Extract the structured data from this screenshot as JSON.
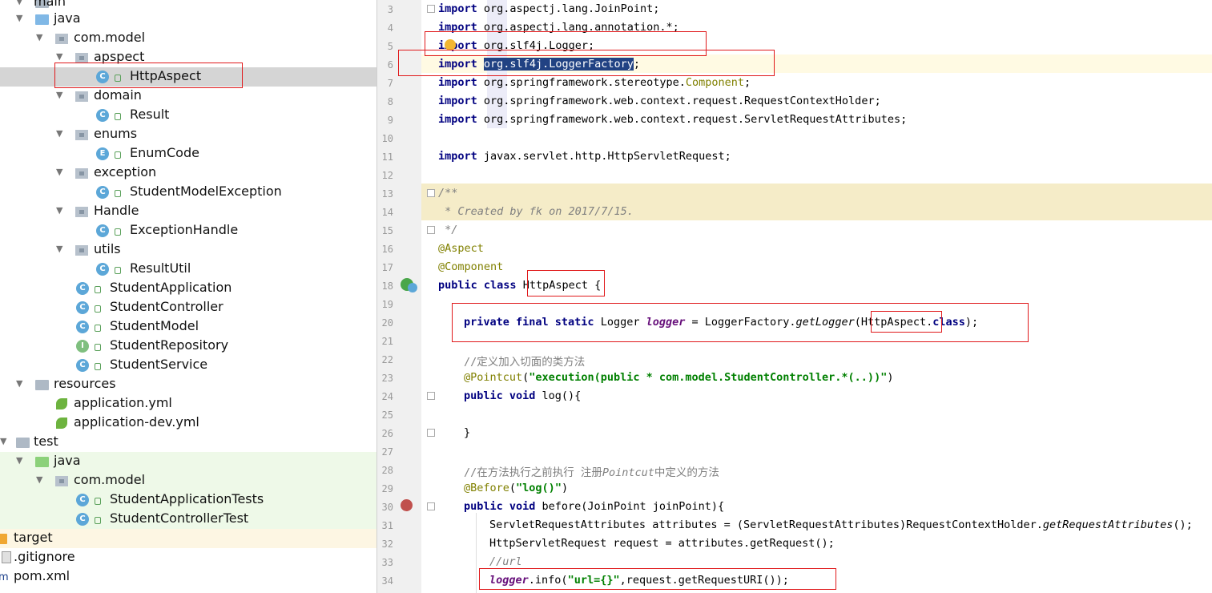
{
  "project_tree": {
    "items": [
      {
        "label": "main",
        "kind": "folder"
      },
      {
        "label": "java",
        "kind": "folder-blue"
      },
      {
        "label": "com.model",
        "kind": "package"
      },
      {
        "label": "apspect",
        "kind": "package"
      },
      {
        "label": "HttpAspect",
        "kind": "class",
        "badge": "C",
        "selected": true
      },
      {
        "label": "domain",
        "kind": "package"
      },
      {
        "label": "Result",
        "kind": "class",
        "badge": "C"
      },
      {
        "label": "enums",
        "kind": "package"
      },
      {
        "label": "EnumCode",
        "kind": "enum",
        "badge": "E"
      },
      {
        "label": "exception",
        "kind": "package"
      },
      {
        "label": "StudentModelException",
        "kind": "class",
        "badge": "C"
      },
      {
        "label": "Handle",
        "kind": "package"
      },
      {
        "label": "ExceptionHandle",
        "kind": "class",
        "badge": "C"
      },
      {
        "label": "utils",
        "kind": "package"
      },
      {
        "label": "ResultUtil",
        "kind": "class",
        "badge": "C"
      },
      {
        "label": "StudentApplication",
        "kind": "class",
        "badge": "C"
      },
      {
        "label": "StudentController",
        "kind": "class",
        "badge": "C"
      },
      {
        "label": "StudentModel",
        "kind": "class",
        "badge": "C"
      },
      {
        "label": "StudentRepository",
        "kind": "interface",
        "badge": "I"
      },
      {
        "label": "StudentService",
        "kind": "class",
        "badge": "C"
      },
      {
        "label": "resources",
        "kind": "folder"
      },
      {
        "label": "application.yml",
        "kind": "spring-yml"
      },
      {
        "label": "application-dev.yml",
        "kind": "spring-yml"
      },
      {
        "label": "test",
        "kind": "folder"
      },
      {
        "label": "java",
        "kind": "folder-green"
      },
      {
        "label": "com.model",
        "kind": "package"
      },
      {
        "label": "StudentApplicationTests",
        "kind": "class",
        "badge": "C"
      },
      {
        "label": "StudentControllerTest",
        "kind": "class",
        "badge": "C"
      },
      {
        "label": "target",
        "kind": "folder-orange"
      },
      {
        "label": ".gitignore",
        "kind": "file"
      },
      {
        "label": "pom.xml",
        "kind": "maven"
      }
    ]
  },
  "editor": {
    "line_numbers": [
      "3",
      "4",
      "5",
      "6",
      "7",
      "8",
      "9",
      "10",
      "11",
      "12",
      "13",
      "14",
      "15",
      "16",
      "17",
      "18",
      "19",
      "20",
      "21",
      "22",
      "23",
      "24",
      "25",
      "26",
      "27",
      "28",
      "29",
      "30",
      "31",
      "32",
      "33",
      "34"
    ],
    "code": {
      "l3_kw": "import",
      "l3_rest": " org.aspectj.lang.JoinPoint;",
      "l4_kw": "import",
      "l4_rest": " org.aspectj.lang.annotation.*;",
      "l5_kw": "import",
      "l5_rest": " org.slf4j.Logger;",
      "l6_kw": "import",
      "l6_sel": "org.slf4j.LoggerFactory",
      "l6_end": ";",
      "l7_kw": "import",
      "l7_a": " org.springframework.stereotype.",
      "l7_b": "Component",
      "l7_c": ";",
      "l8_kw": "import",
      "l8_rest": " org.springframework.web.context.request.RequestContextHolder;",
      "l9_kw": "import",
      "l9_rest": " org.springframework.web.context.request.ServletRequestAttributes;",
      "l11_kw": "import",
      "l11_rest": " javax.servlet.http.HttpServletRequest;",
      "l13": "/**",
      "l14": " * Created by fk on 2017/7/15.",
      "l15": " */",
      "l16": "@Aspect",
      "l17": "@Component",
      "l18_kw": "public class",
      "l18_name": "HttpAspect",
      "l18_end": " {",
      "l20_kw": "private final static",
      "l20_a": " Logger ",
      "l20_fld": "logger",
      "l20_b": " = LoggerFactory.",
      "l20_m": "getLogger",
      "l20_c": "(",
      "l20_cls": "HttpAspect.",
      "l20_kw2": "class",
      "l20_d": ");",
      "l22": "//定义加入切面的类方法",
      "l23_ann": "@Pointcut",
      "l23_a": "(",
      "l23_str": "\"execution(public * com.model.StudentController.*(..))\"",
      "l23_b": ")",
      "l24_kw": "public void",
      "l24_rest": " log(){",
      "l26": "}",
      "l28_a": "//在方法执行之前执行 注册",
      "l28_b": "Pointcut",
      "l28_c": "中定义的方法",
      "l29_ann": "@Before",
      "l29_a": "(",
      "l29_str": "\"log()\"",
      "l29_b": ")",
      "l30_kw": "public void",
      "l30_rest": " before(JoinPoint joinPoint){",
      "l31_a": "ServletRequestAttributes attributes = (ServletRequestAttributes)RequestContextHolder.",
      "l31_m": "getRequestAttributes",
      "l31_b": "();",
      "l32": "HttpServletRequest request = attributes.getRequest();",
      "l33": "//url",
      "l34_fld": "logger",
      "l34_a": ".info(",
      "l34_str": "\"url={}\"",
      "l34_b": ",request.getRequestURI());"
    }
  }
}
